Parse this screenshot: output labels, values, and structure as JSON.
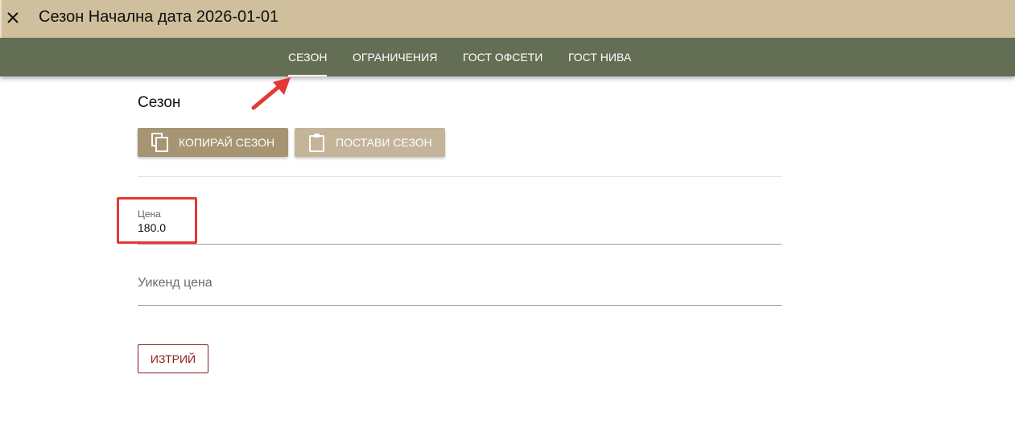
{
  "header": {
    "title": "Сезон Начална дата 2026-01-01",
    "close_icon": "close-icon"
  },
  "tabs": [
    {
      "label": "СЕЗОН",
      "active": true
    },
    {
      "label": "ОГРАНИЧЕНИЯ",
      "active": false
    },
    {
      "label": "ГОСТ ОФСЕТИ",
      "active": false
    },
    {
      "label": "ГОСТ НИВА",
      "active": false
    }
  ],
  "section": {
    "title": "Сезон"
  },
  "actions": {
    "copy_label": "КОПИРАЙ СЕЗОН",
    "copy_icon": "copy-icon",
    "paste_label": "ПОСТАВИ СЕЗОН",
    "paste_icon": "clipboard-icon"
  },
  "form": {
    "price": {
      "label": "Цена",
      "value": "180.0"
    },
    "weekend_price": {
      "label": "Уикенд цена",
      "value": ""
    }
  },
  "delete_label": "ИЗТРИЙ",
  "colors": {
    "header_bg": "#cfbf9c",
    "tabbar_bg": "#636e55",
    "primary_button": "#a69473",
    "disabled_button": "#c4b49a",
    "danger": "#8b1a1a",
    "annotation": "#e53935"
  }
}
